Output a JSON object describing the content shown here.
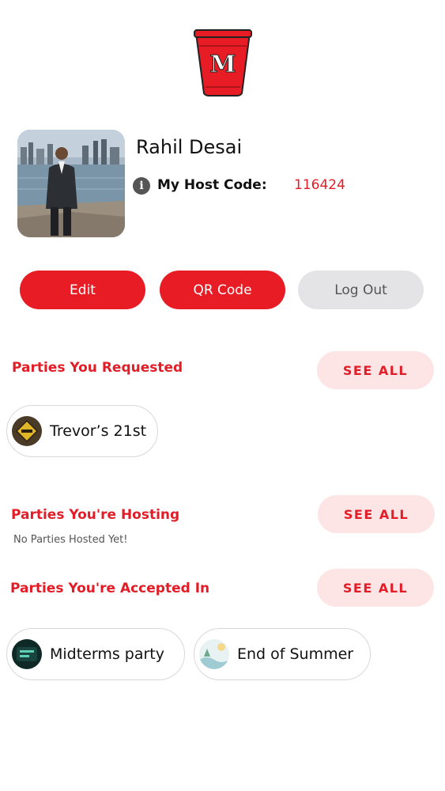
{
  "colors": {
    "brand_red": "#e81c24",
    "accent_text": "#e31d28",
    "see_all_bg": "#fde4e5",
    "neutral_button": "#e4e4e6"
  },
  "logo": {
    "letter": "M",
    "icon": "red-cup-logo-icon"
  },
  "profile": {
    "name": "Rahil Desai",
    "host_code_label": "My Host Code:",
    "host_code": "116424",
    "info_glyph": "i"
  },
  "actions": {
    "edit": "Edit",
    "qr_code": "QR Code",
    "log_out": "Log Out"
  },
  "sections": {
    "requested": {
      "title": "Parties You Requested",
      "see_all": "SEE ALL",
      "parties": [
        {
          "name": "Trevor’s 21st"
        }
      ]
    },
    "hosting": {
      "title": "Parties You're Hosting",
      "see_all": "SEE ALL",
      "empty_text": "No Parties Hosted Yet!"
    },
    "accepted": {
      "title": "Parties You're Accepted In",
      "see_all": "SEE ALL",
      "parties": [
        {
          "name": "Midterms party"
        },
        {
          "name": "End of Summer"
        }
      ]
    }
  }
}
